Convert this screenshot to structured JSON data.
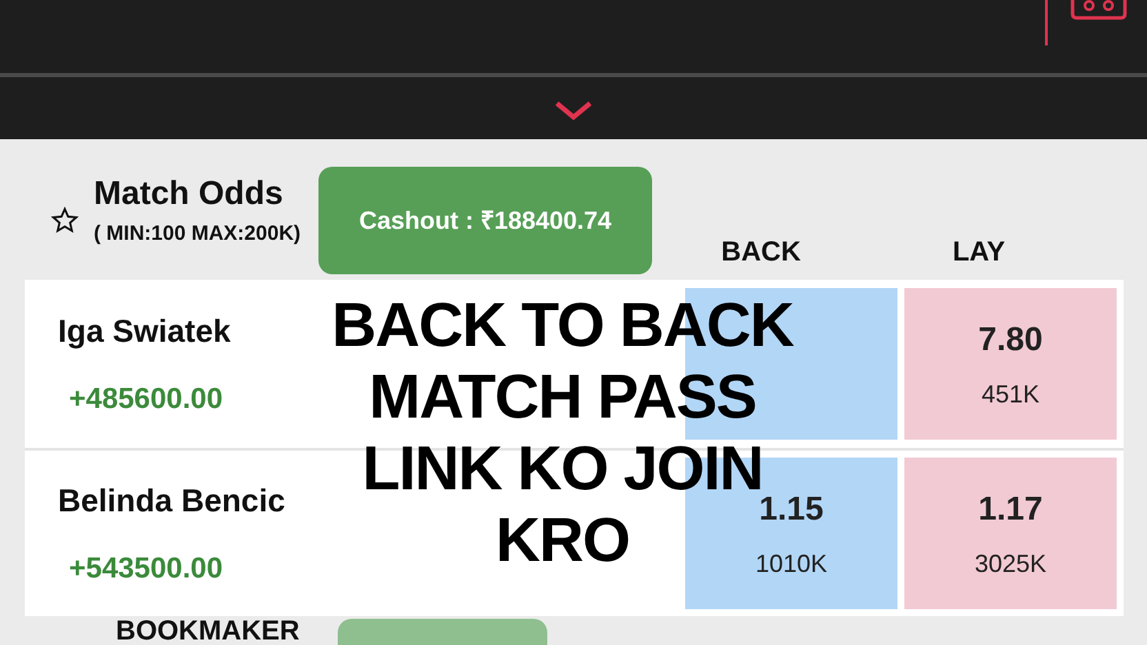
{
  "market": {
    "title": "Match Odds",
    "limits": "( MIN:100 MAX:200K)",
    "cashout": "Cashout : ₹188400.74",
    "columns": [
      "BACK",
      "LAY"
    ]
  },
  "runners": [
    {
      "name": "Iga Swiatek",
      "profit": "+485600.00",
      "lay": {
        "odds": "7.80",
        "volume": "451K"
      }
    },
    {
      "name": "Belinda Bencic",
      "profit": "+543500.00",
      "back": {
        "odds": "1.15",
        "volume": "1010K"
      },
      "lay": {
        "odds": "1.17",
        "volume": "3025K"
      }
    }
  ],
  "next_market": {
    "title": "BOOKMAKER"
  },
  "overlay_caption": [
    "BACK TO BACK",
    "MATCH PASS",
    "LINK KO JOIN",
    "KRO"
  ]
}
